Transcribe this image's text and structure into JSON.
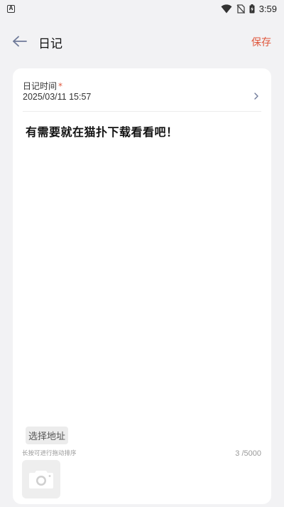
{
  "status": {
    "time": "3:59"
  },
  "header": {
    "title": "日记",
    "save_label": "保存"
  },
  "diary": {
    "time_label": "日记时间",
    "required_mark": "*",
    "time_value": "2025/03/11 15:57",
    "content": "有需要就在猫扑下载看看吧！",
    "address_button": "选择地址",
    "drag_hint": "长按可进行拖动排序",
    "char_count": "3 /5000"
  },
  "colors": {
    "accent": "#e0573c",
    "background": "#f2f2f4",
    "card": "#ffffff"
  },
  "icons": {
    "back": "arrow-left-icon",
    "chevron": "chevron-right-icon",
    "camera": "camera-icon"
  }
}
